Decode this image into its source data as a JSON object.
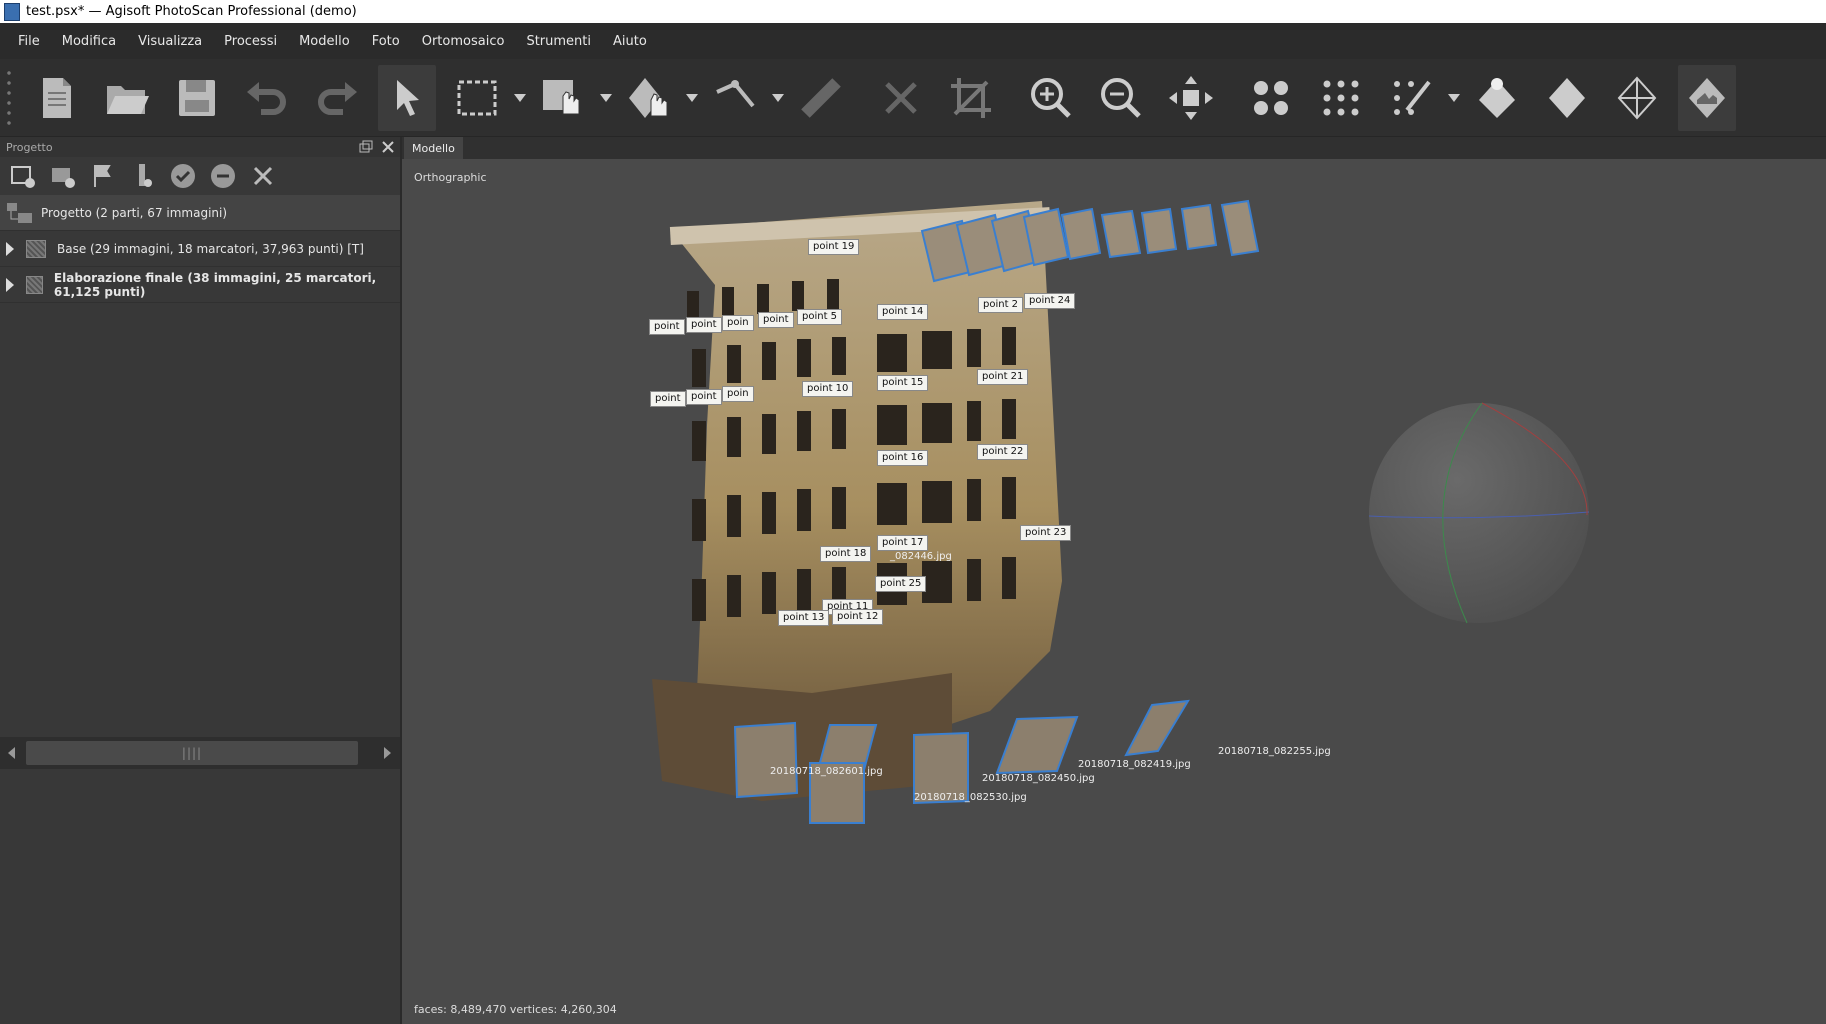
{
  "window": {
    "title": "test.psx* — Agisoft PhotoScan Professional (demo)"
  },
  "menu": [
    "File",
    "Modifica",
    "Visualizza",
    "Processi",
    "Modello",
    "Foto",
    "Ortomosaico",
    "Strumenti",
    "Aiuto"
  ],
  "toolbar": [
    {
      "name": "new-icon"
    },
    {
      "name": "open-icon"
    },
    {
      "name": "save-icon"
    },
    {
      "name": "undo-icon"
    },
    {
      "name": "redo-icon"
    },
    {
      "name": "navigation-icon"
    },
    {
      "name": "rect-select-icon"
    },
    {
      "name": "model-select-icon"
    },
    {
      "name": "move-object-icon"
    },
    {
      "name": "ruler-icon"
    },
    {
      "name": "measure-icon"
    },
    {
      "name": "delete-icon"
    },
    {
      "name": "crop-icon"
    },
    {
      "name": "zoom-in-icon"
    },
    {
      "name": "zoom-out-icon"
    },
    {
      "name": "reset-view-icon"
    },
    {
      "name": "points-icon"
    },
    {
      "name": "dense-cloud-icon"
    },
    {
      "name": "classify-icon"
    },
    {
      "name": "shaded-icon"
    },
    {
      "name": "solid-icon"
    },
    {
      "name": "wireframe-icon"
    },
    {
      "name": "textured-icon"
    }
  ],
  "project_panel": {
    "title": "Progetto",
    "root": "Progetto (2 parti, 67 immagini)",
    "chunks": [
      {
        "label": "Base (29 immagini, 18 marcatori, 37,963 punti) [T]",
        "bold": false
      },
      {
        "label": "Elaborazione finale (38 immagini, 25 marcatori, 61,125 punti)",
        "bold": true
      }
    ]
  },
  "viewport": {
    "tab": "Modello",
    "projection": "Orthographic",
    "status": "faces: 8,489,470 vertices: 4,260,304",
    "markers": [
      "point 19",
      "point 5",
      "point 14",
      "point 2",
      "point 24",
      "point 10",
      "point 15",
      "point 21",
      "point 16",
      "point 22",
      "point 23",
      "point 17",
      "point 18",
      "point 25",
      "point 11",
      "point 12",
      "point 13",
      "point",
      "point",
      "poin",
      "point",
      "point",
      "point",
      "poin"
    ],
    "photo_labels": [
      "20180718_082255.jpg",
      "20180718_082419.jpg",
      "20180718_082530.jpg",
      "20180718_082601.jpg",
      "20180718_082450.jpg",
      "_082446.jpg"
    ]
  }
}
